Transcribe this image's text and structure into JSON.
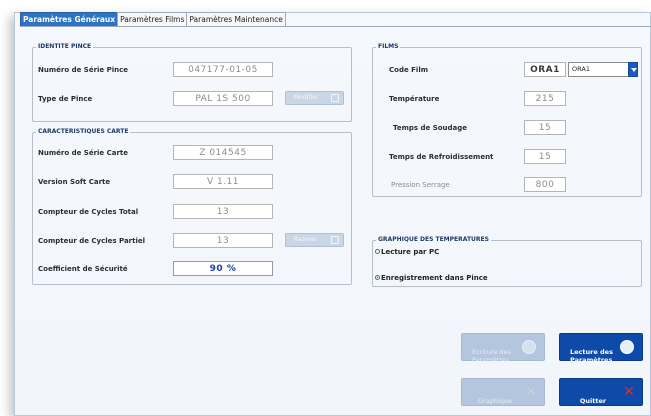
{
  "tabs": [
    {
      "label": "Paramètres Généraux",
      "active": true
    },
    {
      "label": "Paramètres Films",
      "active": false
    },
    {
      "label": "Paramètres Maintenance",
      "active": false
    }
  ],
  "identite": {
    "title": "IDENTITE PINCE",
    "serie_label": "Numéro de Série Pince",
    "serie_value": "047177-01-05",
    "type_label": "Type de Pince",
    "type_value": "PAL 1S 500",
    "modifier_label": "Modifier"
  },
  "carte": {
    "title": "CARACTERISTIQUES CARTE",
    "serie_label": "Numéro de Série Carte",
    "serie_value": "Z 014545",
    "version_label": "Version Soft Carte",
    "version_value": "V 1.11",
    "total_label": "Compteur de Cycles Total",
    "total_value": "13",
    "partiel_label": "Compteur de Cycles Partiel",
    "partiel_value": "13",
    "razerer_label": "Razerer",
    "securite_label": "Coefficient de Sécurité",
    "securite_value": "90 %"
  },
  "films": {
    "title": "FILMS",
    "code_label": "Code Film",
    "code_value": "ORA1",
    "code_select": "ORA1",
    "temp_label": "Température",
    "temp_value": "215",
    "soudage_label": "Temps de Soudage",
    "soudage_value": "15",
    "refroid_label": "Temps de Refroidissement",
    "refroid_value": "15",
    "pression_label": "Pression Serrage",
    "pression_value": "800"
  },
  "graph": {
    "title": "GRAPHIQUE DES TEMPERATURES",
    "option1": "Lecture par PC",
    "option2": "Enregistrement dans Pince",
    "selected": "option2"
  },
  "buttons": {
    "ecriture": "Ecriture des\nParamètres",
    "lecture": "Lecture des\nParamètres",
    "graphique": "Graphique",
    "quitter": "Quitter"
  },
  "colors": {
    "tab_active": "#2c73c4",
    "button_active": "#0e4aa8",
    "button_disabled": "#b3c6de",
    "value_highlight": "#1d3fa8",
    "quit_icon": "#e8292b"
  }
}
